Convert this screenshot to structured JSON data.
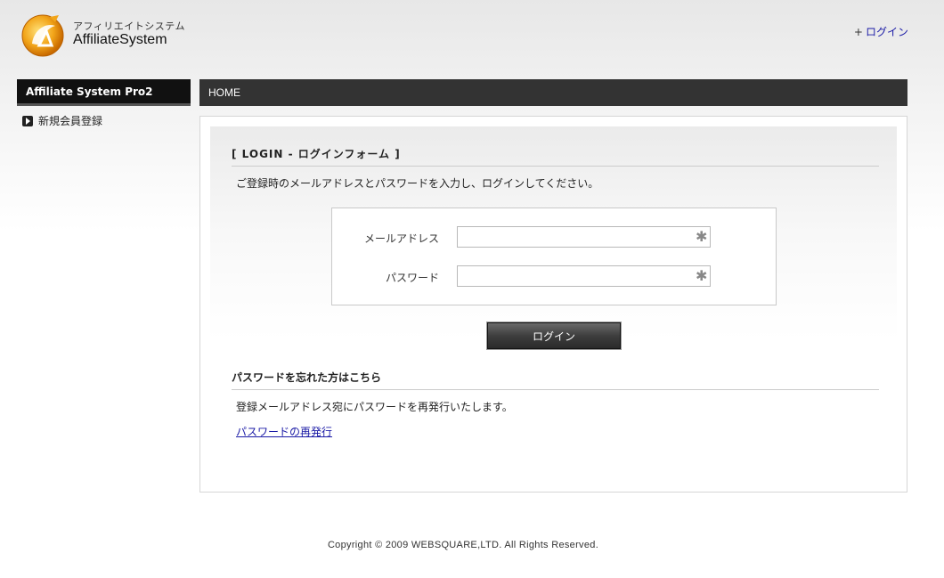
{
  "header": {
    "logo_sub": "アフィリエイトシステム",
    "logo_main": "AffiliateSystem",
    "login_plus": "+",
    "login_link": "ログイン"
  },
  "sidebar": {
    "title": "Affiliate System Pro2",
    "items": [
      {
        "label": "新規会員登録",
        "icon": "arrow-right-icon"
      }
    ]
  },
  "breadcrumb": {
    "label": "HOME"
  },
  "login": {
    "title": "[ LOGIN - ログインフォーム ]",
    "description": "ご登録時のメールアドレスとパスワードを入力し、ログインしてください。",
    "email_label": "メールアドレス",
    "email_value": "",
    "password_label": "パスワード",
    "password_value": "",
    "required_mark": "✱",
    "button_label": "ログイン"
  },
  "forgot": {
    "title": "パスワードを忘れた方はこちら",
    "description": "登録メールアドレス宛にパスワードを再発行いたします。",
    "link_label": "パスワードの再発行"
  },
  "footer": {
    "copyright": "Copyright © 2009 WEBSQUARE,LTD. All Rights Reserved."
  },
  "colors": {
    "link": "#1a1aa6",
    "bar_dark": "#333333",
    "sidebar_title_bg": "#111111"
  }
}
